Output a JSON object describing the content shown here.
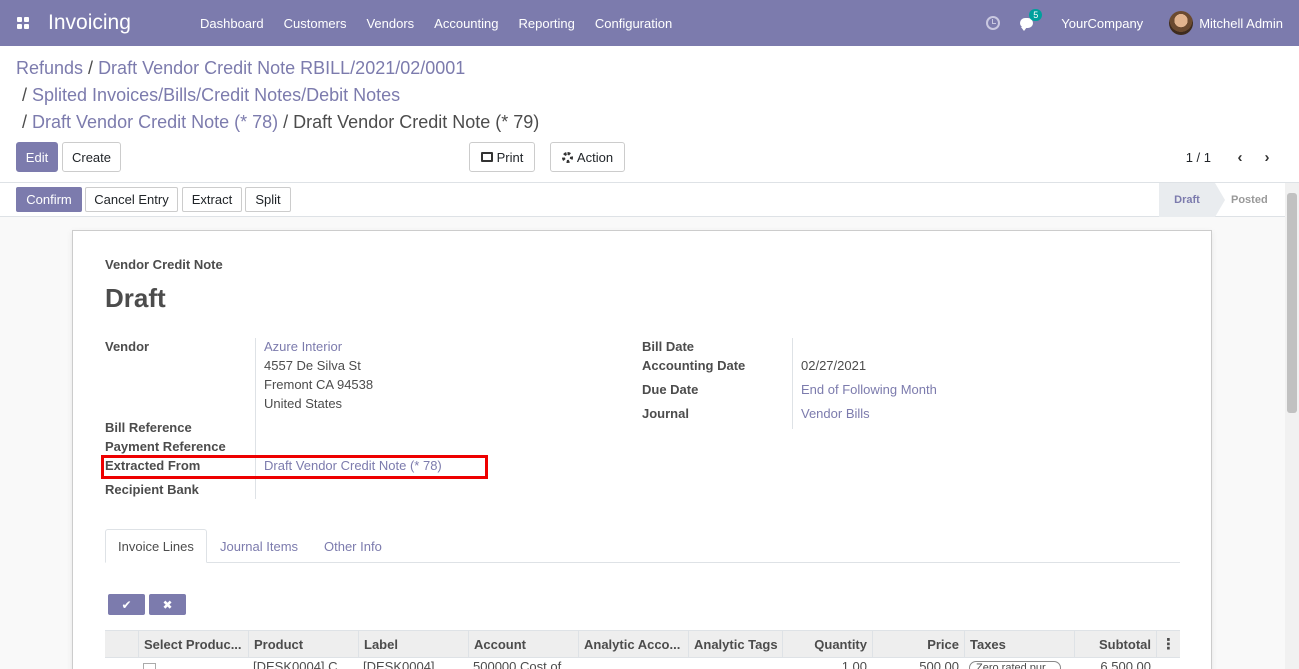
{
  "app": {
    "name": "Invoicing",
    "menu": [
      "Dashboard",
      "Customers",
      "Vendors",
      "Accounting",
      "Reporting",
      "Configuration"
    ],
    "chat_badge": "5",
    "company": "YourCompany",
    "user": "Mitchell Admin"
  },
  "breadcrumb": {
    "line1": [
      "Refunds",
      "Draft Vendor Credit Note RBILL/2021/02/0001"
    ],
    "line2": [
      "Splited Invoices/Bills/Credit Notes/Debit Notes"
    ],
    "line3_link": "Draft Vendor Credit Note (* 78)",
    "current": "Draft Vendor Credit Note (* 79)",
    "separator": "/"
  },
  "toolbar": {
    "edit": "Edit",
    "create": "Create",
    "print": "Print",
    "action": "Action",
    "pager": "1 / 1"
  },
  "statusbar": {
    "buttons": [
      "Confirm",
      "Cancel Entry",
      "Extract",
      "Split"
    ],
    "stages": [
      "Draft",
      "Posted"
    ],
    "active_stage": "Draft"
  },
  "form": {
    "doc_type": "Vendor Credit Note",
    "title": "Draft",
    "left": {
      "vendor_label": "Vendor",
      "vendor_name": "Azure Interior",
      "vendor_address": [
        "4557 De Silva St",
        "Fremont CA 94538",
        "United States"
      ],
      "bill_reference_label": "Bill Reference",
      "payment_reference_label": "Payment Reference",
      "extracted_from_label": "Extracted From",
      "extracted_from_value": "Draft Vendor Credit Note (* 78)",
      "recipient_bank_label": "Recipient Bank"
    },
    "right": {
      "bill_date_label": "Bill Date",
      "accounting_date_label": "Accounting Date",
      "accounting_date_value": "02/27/2021",
      "due_date_label": "Due Date",
      "due_date_value": "End of Following Month",
      "journal_label": "Journal",
      "journal_value": "Vendor Bills"
    }
  },
  "tabs": [
    "Invoice Lines",
    "Journal Items",
    "Other Info"
  ],
  "lines": {
    "confirm_glyph": "✔",
    "discard_glyph": "✖",
    "columns": [
      "Select Produc...",
      "Product",
      "Label",
      "Account",
      "Analytic Acco...",
      "Analytic Tags",
      "Quantity",
      "Price",
      "Taxes",
      "Subtotal"
    ],
    "row": {
      "product": "[DESK0004] C...",
      "label": "[DESK0004]...",
      "account": "500000 Cost of...",
      "quantity": "1.00",
      "price": "500.00",
      "taxes": "Zero rated pur...",
      "subtotal": "6,500.00"
    }
  }
}
